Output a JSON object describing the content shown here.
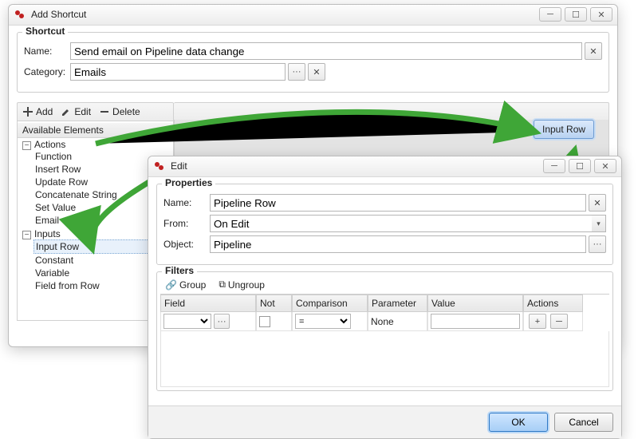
{
  "main": {
    "title": "Add Shortcut",
    "shortcut": {
      "legend": "Shortcut",
      "name_label": "Name:",
      "name_value": "Send email on Pipeline data change",
      "category_label": "Category:",
      "category_value": "Emails"
    },
    "toolbar": {
      "add": "Add",
      "edit": "Edit",
      "delete": "Delete"
    },
    "tree": {
      "header": "Available Elements",
      "actions_label": "Actions",
      "actions": [
        "Function",
        "Insert Row",
        "Update Row",
        "Concatenate String",
        "Set Value",
        "Email"
      ],
      "inputs_label": "Inputs",
      "inputs": [
        "Input Row",
        "Constant",
        "Variable",
        "Field from Row"
      ]
    },
    "canvas_button": "Input Row"
  },
  "edit": {
    "title": "Edit",
    "properties": {
      "legend": "Properties",
      "name_label": "Name:",
      "name_value": "Pipeline Row",
      "from_label": "From:",
      "from_value": "On Edit",
      "object_label": "Object:",
      "object_value": "Pipeline"
    },
    "filters": {
      "legend": "Filters",
      "group": "Group",
      "ungroup": "Ungroup",
      "columns": {
        "field": "Field",
        "not": "Not",
        "comparison": "Comparison",
        "parameter": "Parameter",
        "value": "Value",
        "actions": "Actions"
      },
      "row": {
        "field": "",
        "not": false,
        "comparison": "=",
        "parameter": "None",
        "value": ""
      }
    },
    "buttons": {
      "ok": "OK",
      "cancel": "Cancel"
    }
  },
  "icons": {
    "minus": "─",
    "square": "☐",
    "close": "✕",
    "dots": "···",
    "clear": "✕",
    "down": "▾",
    "plus": "+",
    "pencil": "✎",
    "link": "🔗",
    "unlink": "⧉"
  }
}
